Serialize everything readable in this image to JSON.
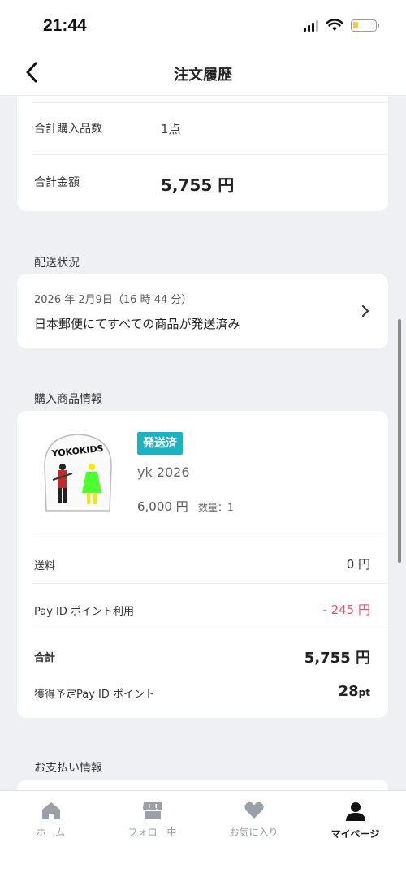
{
  "status_bar": {
    "time": "21:44"
  },
  "nav": {
    "title": "注文履歴"
  },
  "summary": {
    "count_label": "合計購入品数",
    "count_value": "1点",
    "total_label": "合計金額",
    "total_value": "5,755 円"
  },
  "shipping": {
    "section_title": "配送状況",
    "date": "2026 年 2月9日（16 時 44 分）",
    "status": "日本郵便にてすべての商品が発送済み"
  },
  "product": {
    "section_title": "購入商品情報",
    "badge": "発送済",
    "name": "yk 2026",
    "price": "6,000 円",
    "quantity": "数量：1",
    "image_text": "YOKOKIDS"
  },
  "breakdown": {
    "shipping_label": "送料",
    "shipping_value": "0 円",
    "points_used_label": "Pay ID ポイント利用",
    "points_used_value": "- 245 円",
    "total_label": "合計",
    "total_value": "5,755 円",
    "earn_label": "獲得予定Pay ID ポイント",
    "earn_value": "28",
    "earn_unit": "pt"
  },
  "payment": {
    "section_title": "お支払い情報"
  },
  "tabs": [
    {
      "label": "ホーム",
      "icon": "home-icon"
    },
    {
      "label": "フォロー中",
      "icon": "store-icon"
    },
    {
      "label": "お気に入り",
      "icon": "heart-icon"
    },
    {
      "label": "マイページ",
      "icon": "person-icon"
    }
  ],
  "colors": {
    "badge": "#1bb3c2",
    "points_used": "#e4536a",
    "active_tab": "#222222",
    "inactive_tab": "#9aa0a8"
  }
}
